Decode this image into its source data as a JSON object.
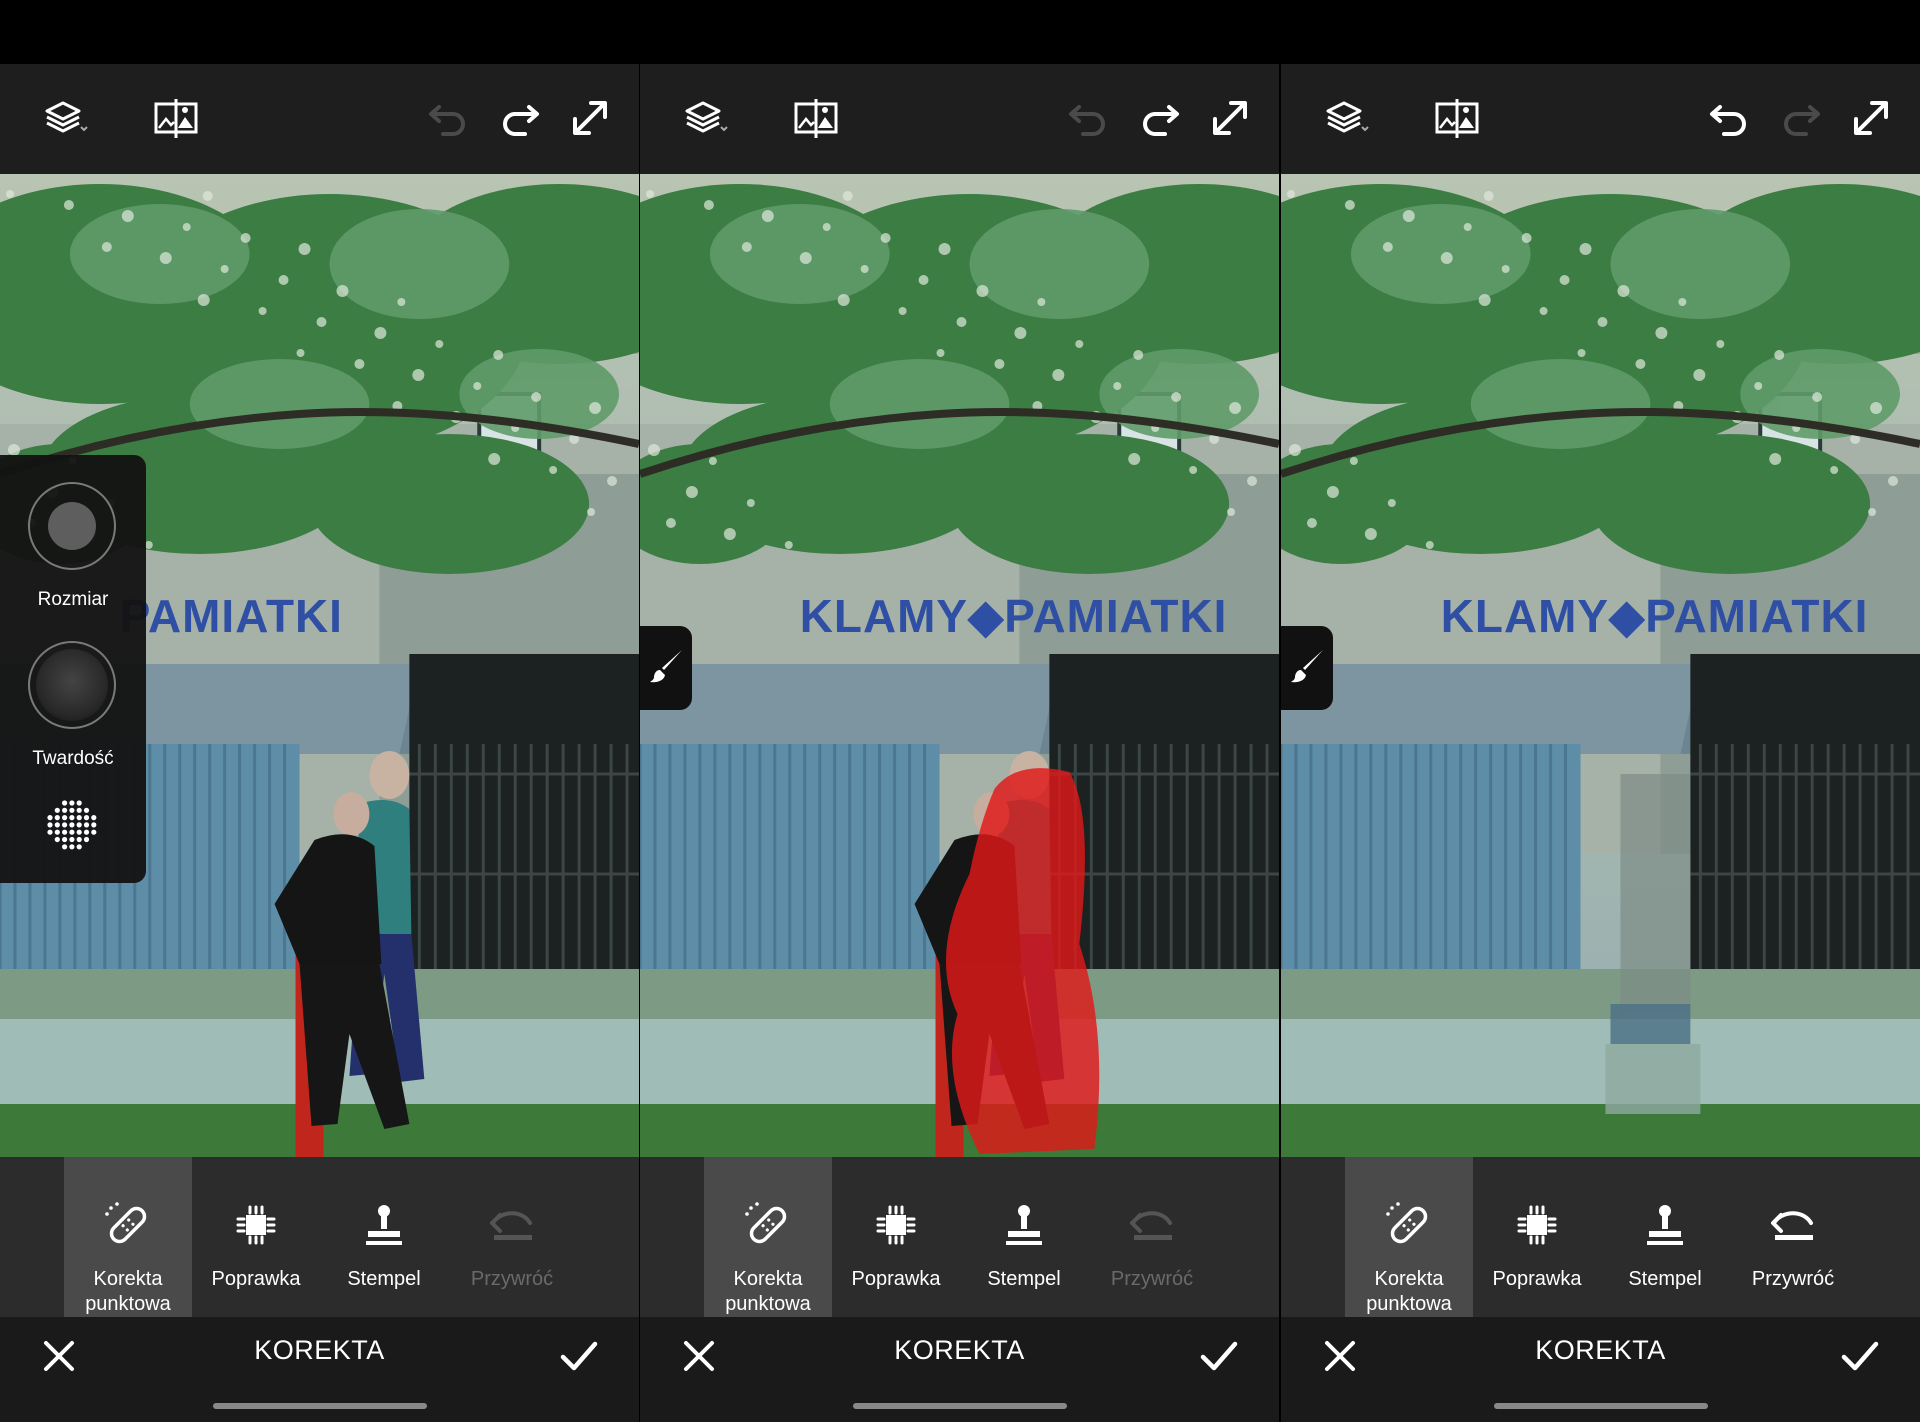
{
  "panels": [
    {
      "title": "KOREKTA",
      "undo_enabled": false,
      "redo_enabled": true,
      "show_side_panel": true,
      "show_brush_button": false,
      "show_red_mask": false,
      "people_removed": false,
      "side_panel": {
        "size_label": "Rozmiar",
        "hardness_label": "Twardość"
      },
      "sign_text": "PAMIATKI",
      "tools": [
        {
          "label_1": "Korekta",
          "label_2": "punktowa",
          "icon": "bandage-icon",
          "active": true,
          "enabled": true
        },
        {
          "label_1": "Poprawka",
          "label_2": "",
          "icon": "patch-icon",
          "active": false,
          "enabled": true
        },
        {
          "label_1": "Stempel",
          "label_2": "",
          "icon": "stamp-icon",
          "active": false,
          "enabled": true
        },
        {
          "label_1": "Przywróć",
          "label_2": "",
          "icon": "restore-icon",
          "active": false,
          "enabled": false
        }
      ]
    },
    {
      "title": "KOREKTA",
      "undo_enabled": false,
      "redo_enabled": true,
      "show_side_panel": false,
      "show_brush_button": true,
      "show_red_mask": true,
      "people_removed": false,
      "sign_text": "KLAMY◆PAMIATKI",
      "tools": [
        {
          "label_1": "Korekta",
          "label_2": "punktowa",
          "icon": "bandage-icon",
          "active": true,
          "enabled": true
        },
        {
          "label_1": "Poprawka",
          "label_2": "",
          "icon": "patch-icon",
          "active": false,
          "enabled": true
        },
        {
          "label_1": "Stempel",
          "label_2": "",
          "icon": "stamp-icon",
          "active": false,
          "enabled": true
        },
        {
          "label_1": "Przywróć",
          "label_2": "",
          "icon": "restore-icon",
          "active": false,
          "enabled": false
        }
      ]
    },
    {
      "title": "KOREKTA",
      "undo_enabled": true,
      "redo_enabled": false,
      "show_side_panel": false,
      "show_brush_button": true,
      "show_red_mask": false,
      "people_removed": true,
      "sign_text": "KLAMY◆PAMIATKI",
      "tools": [
        {
          "label_1": "Korekta",
          "label_2": "punktowa",
          "icon": "bandage-icon",
          "active": true,
          "enabled": true
        },
        {
          "label_1": "Poprawka",
          "label_2": "",
          "icon": "patch-icon",
          "active": false,
          "enabled": true
        },
        {
          "label_1": "Stempel",
          "label_2": "",
          "icon": "stamp-icon",
          "active": false,
          "enabled": true
        },
        {
          "label_1": "Przywróć",
          "label_2": "",
          "icon": "restore-icon",
          "active": false,
          "enabled": true
        }
      ]
    }
  ],
  "colors": {
    "mask_red": "#e01818",
    "active_tool_bg": "#4a4a4a",
    "disabled_icon": "#555555",
    "disabled_label": "#6a6a6a"
  }
}
